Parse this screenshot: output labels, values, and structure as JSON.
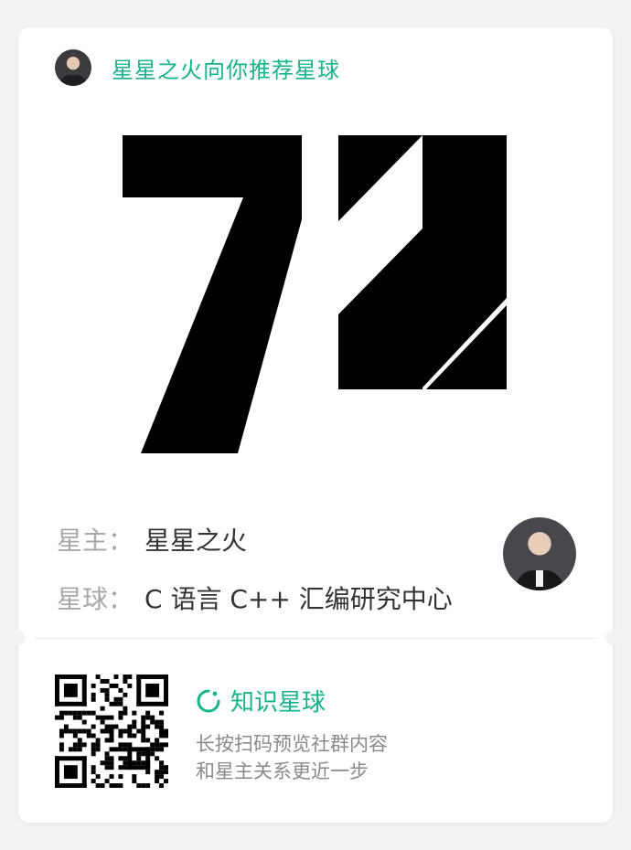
{
  "header": {
    "title": "星星之火向你推荐星球",
    "avatar_icon": "person-avatar-icon"
  },
  "logo": {
    "text": "72",
    "color": "#000000"
  },
  "info": {
    "owner_label": "星主：",
    "owner_name": "星星之火",
    "planet_label": "星球：",
    "planet_name": "C 语言 C++ 汇编研究中心"
  },
  "footer": {
    "brand_name": "知识星球",
    "brand_icon": "circle-arrow-icon",
    "line1": "长按扫码预览社群内容",
    "line2": "和星主关系更近一步",
    "qr_icon": "qr-code-icon"
  },
  "colors": {
    "accent": "#17b38c",
    "background": "#f2f3f5",
    "card": "#ffffff"
  }
}
